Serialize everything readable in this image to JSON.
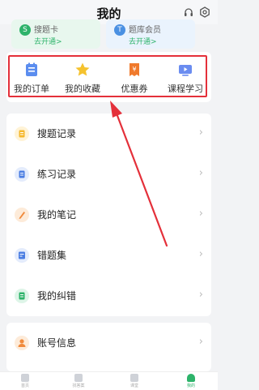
{
  "header": {
    "title": "我的",
    "headset_icon": "headset-icon",
    "settings_icon": "settings-icon"
  },
  "promos": [
    {
      "icon": "S",
      "title": "搜题卡",
      "subtitle": "去开通>",
      "color": "#2db36a",
      "bg": "#e8f7ee"
    },
    {
      "icon": "T",
      "title": "题库会员",
      "subtitle": "去开通>",
      "color": "#4a90e2",
      "bg": "#eaf3fd"
    }
  ],
  "quick_links": [
    {
      "label": "我的订单",
      "icon": "order-icon"
    },
    {
      "label": "我的收藏",
      "icon": "star-icon"
    },
    {
      "label": "优惠券",
      "icon": "coupon-icon"
    },
    {
      "label": "课程学习",
      "icon": "course-icon"
    }
  ],
  "menu": [
    {
      "label": "搜题记录",
      "icon": "search-record-icon",
      "color": "#f5b82e"
    },
    {
      "label": "练习记录",
      "icon": "practice-record-icon",
      "color": "#4a7de2"
    },
    {
      "label": "我的笔记",
      "icon": "note-icon",
      "color": "#f08a3c"
    },
    {
      "label": "错题集",
      "icon": "mistake-icon",
      "color": "#4a7de2"
    },
    {
      "label": "我的纠错",
      "icon": "correction-icon",
      "color": "#2db36a"
    }
  ],
  "account": {
    "label": "账号信息",
    "icon": "account-icon",
    "color": "#f08a3c"
  },
  "tabs": [
    {
      "label": "首页",
      "active": false
    },
    {
      "label": "找答案",
      "active": false
    },
    {
      "label": "课堂",
      "active": false
    },
    {
      "label": "我的",
      "active": true
    }
  ],
  "colors": {
    "accent": "#2db36a",
    "highlight": "#e4303a"
  }
}
